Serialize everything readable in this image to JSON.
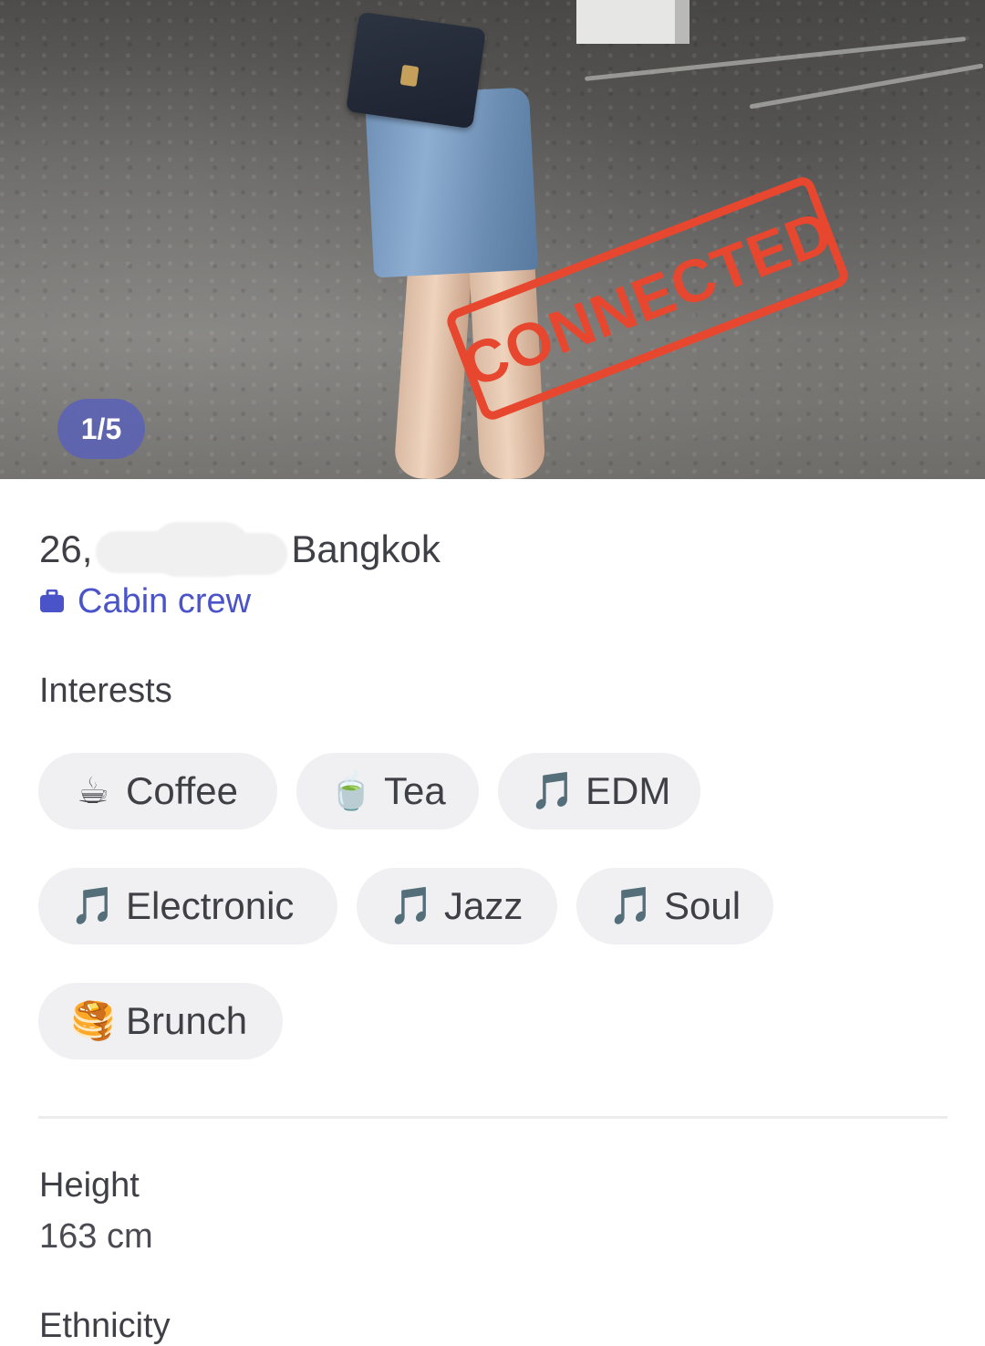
{
  "photo": {
    "counter": "1/5",
    "stamp": "CONNECTED"
  },
  "profile": {
    "age": "26,",
    "city": "Bangkok",
    "job": "Cabin crew"
  },
  "interests": {
    "heading": "Interests",
    "items": [
      {
        "emoji": "☕",
        "label": "Coffee"
      },
      {
        "emoji": "🍵",
        "label": "Tea"
      },
      {
        "emoji": "🎵",
        "label": "EDM"
      },
      {
        "emoji": "🎵",
        "label": "Electronic"
      },
      {
        "emoji": "🎵",
        "label": "Jazz"
      },
      {
        "emoji": "🎵",
        "label": "Soul"
      },
      {
        "emoji": "🥞",
        "label": "Brunch"
      }
    ]
  },
  "details": {
    "height_label": "Height",
    "height_value": "163 cm",
    "ethnicity_label": "Ethnicity"
  },
  "colors": {
    "accent": "#4a54c8",
    "stamp": "#e8472f",
    "chip_bg": "#f0f0f2",
    "counter_bg": "#5c63b2"
  }
}
